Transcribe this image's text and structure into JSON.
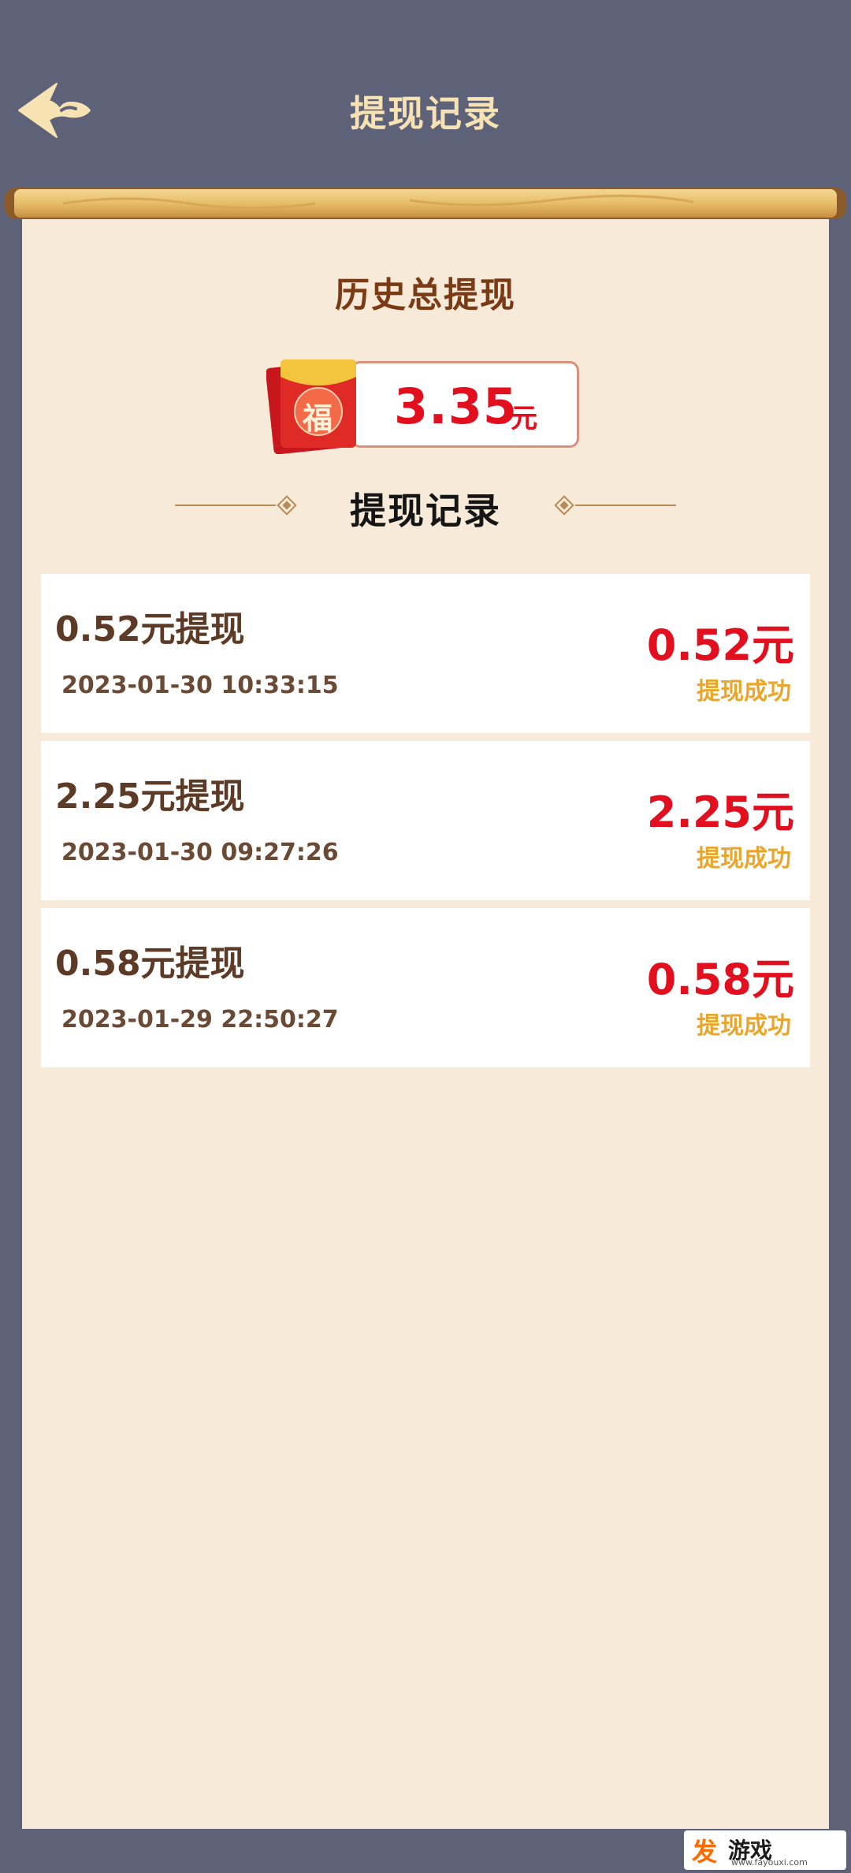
{
  "header": {
    "title": "提现记录",
    "back_icon": "back-arrow-icon"
  },
  "summary": {
    "title": "历史总提现",
    "amount": "3.35",
    "unit": "元",
    "packet_char": "福"
  },
  "records_section": {
    "title": "提现记录"
  },
  "records": [
    {
      "title": "0.52元提现",
      "time": "2023-01-30 10:33:15",
      "amount": "0.52元",
      "status": "提现成功"
    },
    {
      "title": "2.25元提现",
      "time": "2023-01-30 09:27:26",
      "amount": "2.25元",
      "status": "提现成功"
    },
    {
      "title": "0.58元提现",
      "time": "2023-01-29 22:50:27",
      "amount": "0.58元",
      "status": "提现成功"
    }
  ],
  "watermark": {
    "logo": "发",
    "text": "游戏",
    "url": "www.fayouxi.com"
  },
  "colors": {
    "background": "#5d6279",
    "paper": "#f7ead8",
    "amount_red": "#e2101f",
    "status_gold": "#e9a62c",
    "title_brown": "#7a3a14"
  }
}
